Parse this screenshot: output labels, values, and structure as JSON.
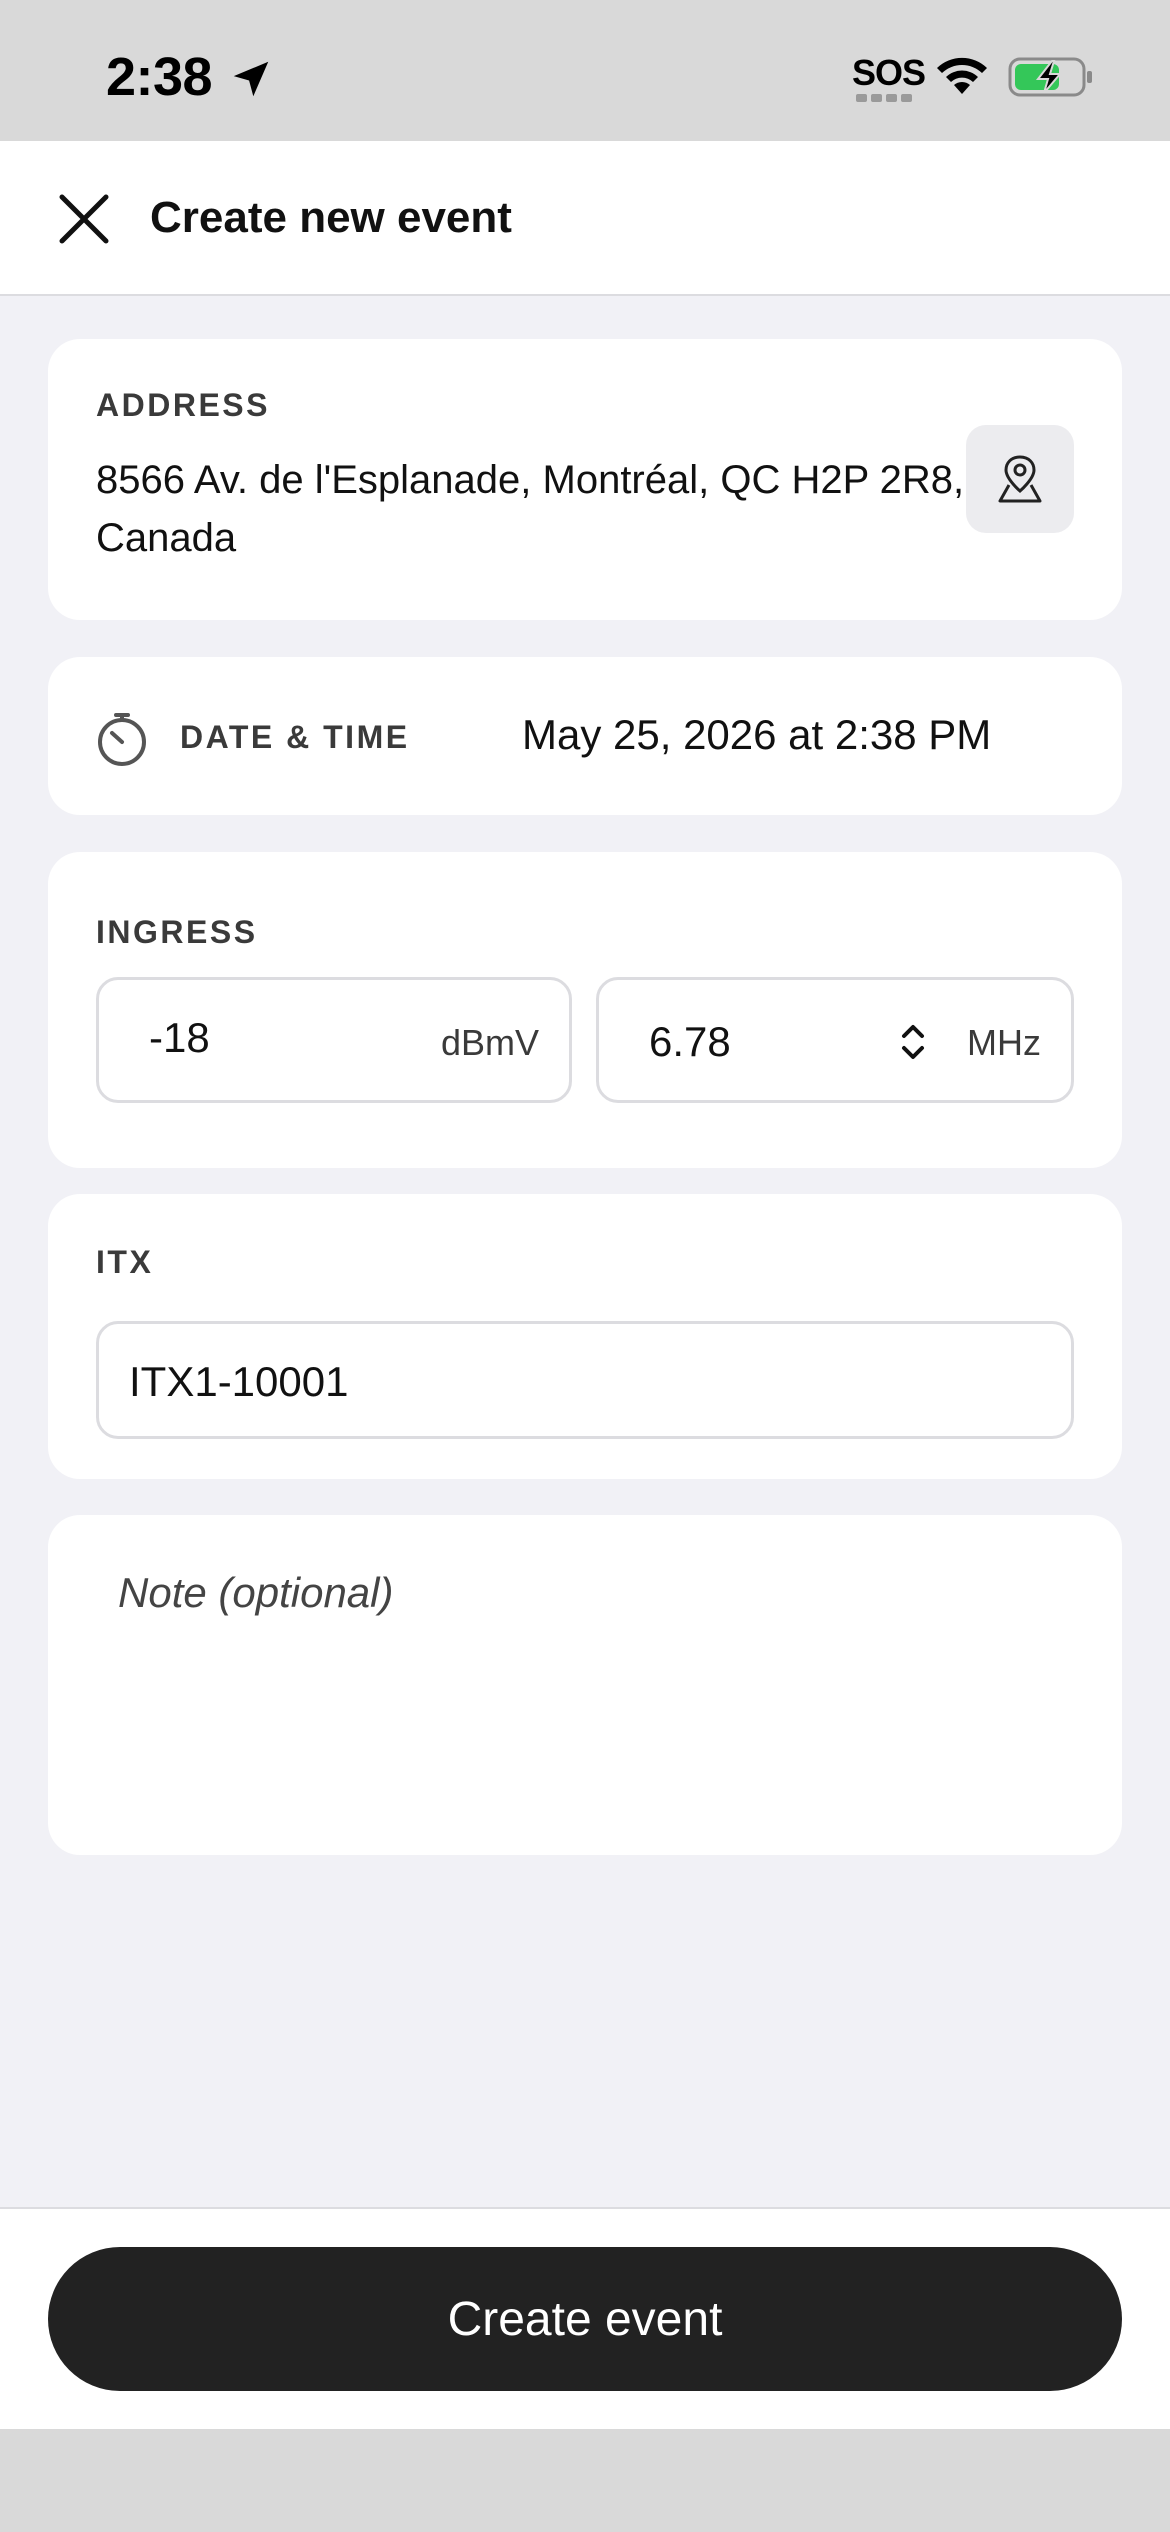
{
  "status_bar": {
    "time": "2:38",
    "sos": "SOS"
  },
  "header": {
    "title": "Create new event"
  },
  "address": {
    "label": "ADDRESS",
    "value": "8566 Av. de l'Esplanade, Montréal, QC H2P 2R8, Canada"
  },
  "datetime": {
    "label": "DATE & TIME",
    "value": "May 25, 2026 at 2:38 PM"
  },
  "ingress": {
    "label": "INGRESS",
    "level_value": "-18",
    "level_unit": "dBmV",
    "frequency_value": "6.78",
    "frequency_unit": "MHz"
  },
  "itx": {
    "label": "ITX",
    "value": "ITX1-10001"
  },
  "note": {
    "placeholder": "Note (optional)"
  },
  "footer": {
    "create_label": "Create event"
  },
  "colors": {
    "sheet_bg": "#f1f1f6",
    "primary_button": "#222222",
    "battery_fill": "#34c759"
  }
}
